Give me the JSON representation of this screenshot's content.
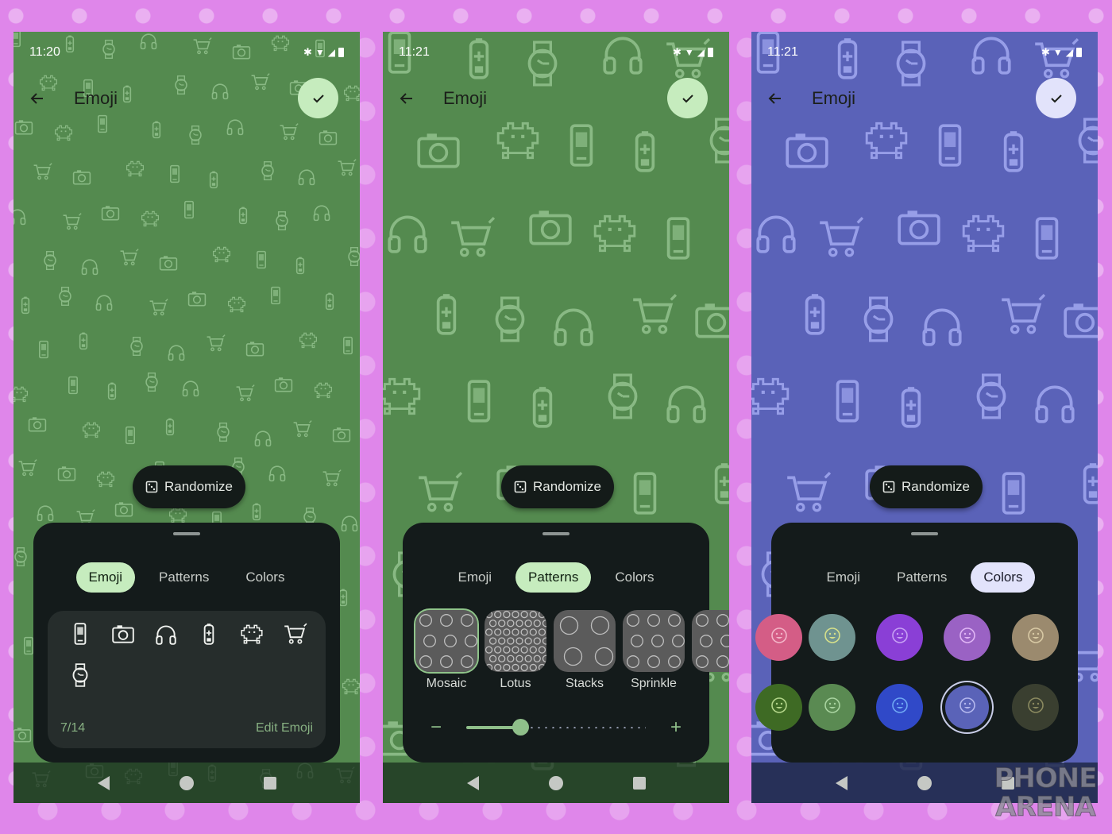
{
  "theme": {
    "page_bg": "#df86ea",
    "green_wallpaper": "#548a4f",
    "green_wallpaper_icon": "#8fbf8a",
    "purple_wallpaper": "#5a62b8",
    "purple_wallpaper_icon": "#9ea5ee",
    "green_accent": "#c6ecbe",
    "purple_accent": "#e2e3fb",
    "sheet_bg": "#141b1b",
    "panel_bg": "#262d2c"
  },
  "screens": [
    {
      "status": {
        "time": "11:20",
        "icons": [
          "bluetooth-icon",
          "wifi-icon",
          "signal-icon",
          "battery-icon"
        ]
      },
      "header": {
        "back_icon": "arrow-left-icon",
        "title": "Emoji",
        "confirm_icon": "check-icon"
      },
      "randomize": {
        "label": "Randomize",
        "icon": "dice-icon"
      },
      "tabs": [
        {
          "label": "Emoji",
          "active": true
        },
        {
          "label": "Patterns",
          "active": false
        },
        {
          "label": "Colors",
          "active": false
        }
      ],
      "emoji_panel": {
        "emojis": [
          "phone-icon",
          "camera-icon",
          "headphones-icon",
          "battery-icon",
          "space-invader-icon",
          "shopping-cart-icon",
          "watch-icon"
        ],
        "count": "7/14",
        "edit_label": "Edit Emoji"
      },
      "nav": [
        "back",
        "home",
        "recents"
      ]
    },
    {
      "status": {
        "time": "11:21",
        "icons": [
          "bluetooth-icon",
          "wifi-icon",
          "signal-icon",
          "battery-icon"
        ]
      },
      "header": {
        "back_icon": "arrow-left-icon",
        "title": "Emoji",
        "confirm_icon": "check-icon"
      },
      "randomize": {
        "label": "Randomize",
        "icon": "dice-icon"
      },
      "tabs": [
        {
          "label": "Emoji",
          "active": false
        },
        {
          "label": "Patterns",
          "active": true
        },
        {
          "label": "Colors",
          "active": false
        }
      ],
      "patterns": {
        "items": [
          {
            "label": "Mosaic",
            "selected": true
          },
          {
            "label": "Lotus",
            "selected": false
          },
          {
            "label": "Stacks",
            "selected": false
          },
          {
            "label": "Sprinkle",
            "selected": false
          },
          {
            "label": "",
            "selected": false
          }
        ],
        "density_slider": {
          "value_fraction": 0.3,
          "minus_label": "−",
          "plus_label": "+"
        }
      },
      "nav": [
        "back",
        "home",
        "recents"
      ]
    },
    {
      "status": {
        "time": "11:21",
        "icons": [
          "bluetooth-icon",
          "wifi-icon",
          "signal-icon",
          "battery-icon"
        ]
      },
      "header": {
        "back_icon": "arrow-left-icon",
        "title": "Emoji",
        "confirm_icon": "check-icon"
      },
      "randomize": {
        "label": "Randomize",
        "icon": "dice-icon"
      },
      "tabs": [
        {
          "label": "Emoji",
          "active": false
        },
        {
          "label": "Patterns",
          "active": false
        },
        {
          "label": "Colors",
          "active": true
        }
      ],
      "colors": {
        "rows": [
          [
            {
              "bg": "#d45d86",
              "face": "#f2b4c8",
              "partial": true
            },
            {
              "bg": "#6f9390",
              "face": "#d6e08a"
            },
            {
              "bg": "#8a3fd6",
              "face": "#c7a0f3"
            },
            {
              "bg": "#9a62c4",
              "face": "#e0b5f5"
            },
            {
              "bg": "#9b8a6e",
              "face": "#d8c9a4"
            }
          ],
          [
            {
              "bg": "#3e6a24",
              "face": "#b3d58a",
              "partial": true
            },
            {
              "bg": "#5a8a52",
              "face": "#a9d4a0"
            },
            {
              "bg": "#3049c8",
              "face": "#6fa8f3"
            },
            {
              "bg": "#5a63b8",
              "face": "#b4b8ee",
              "selected": true
            },
            {
              "bg": "#3a3f30",
              "face": "#8b8a60"
            }
          ]
        ]
      },
      "nav": [
        "back",
        "home",
        "recents"
      ]
    }
  ],
  "watermark": {
    "line1": "PHONE",
    "line2": "ARENA"
  }
}
